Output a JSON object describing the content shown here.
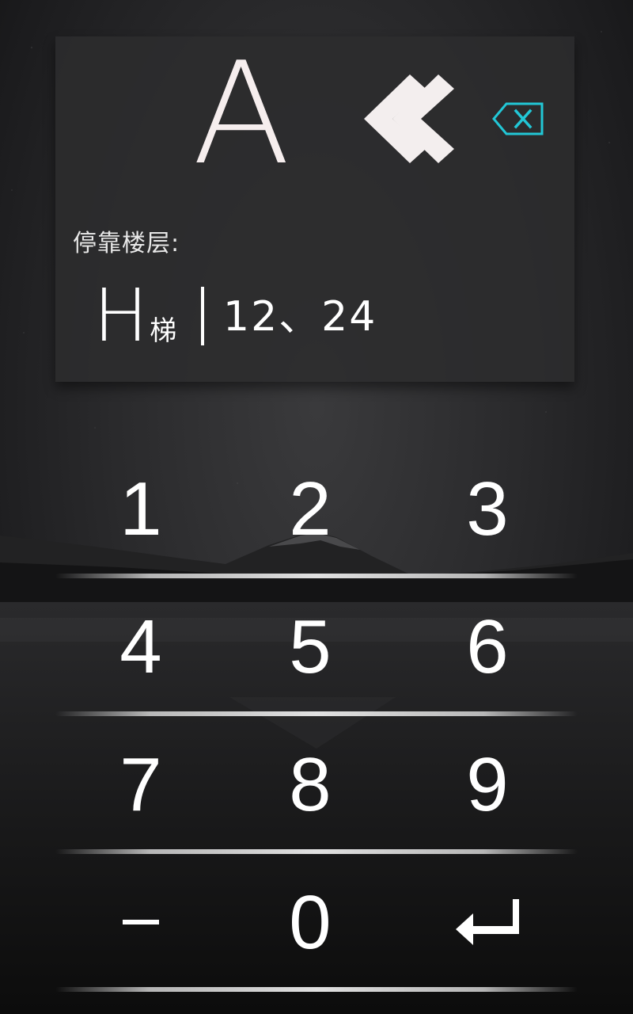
{
  "display": {
    "elevator_letter": "A",
    "back_icon": "double-chevron-left-icon",
    "delete_icon": "backspace-x-icon",
    "accent_color": "#22c7d6"
  },
  "info": {
    "stop_label": "停靠楼层:",
    "elevator_id_main": "H",
    "elevator_id_suffix": "梯",
    "floors": "12、24"
  },
  "keypad": {
    "row1": [
      "1",
      "2",
      "3"
    ],
    "row2": [
      "4",
      "5",
      "6"
    ],
    "row3": [
      "7",
      "8",
      "9"
    ],
    "row4": [
      "–",
      "0",
      "enter-icon"
    ]
  }
}
